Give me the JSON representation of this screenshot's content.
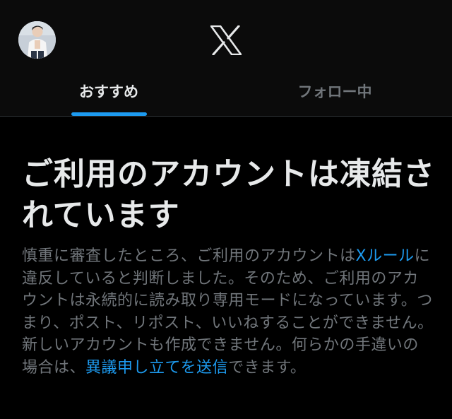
{
  "colors": {
    "background": "#000000",
    "header_background": "#0b0b0b",
    "accent": "#1d9bf0",
    "primary_text": "#e7e9ea",
    "secondary_text": "#71767b"
  },
  "header": {
    "avatar_icon": "user-avatar",
    "logo_icon": "x-logo"
  },
  "tabs": [
    {
      "label": "おすすめ",
      "selected": true
    },
    {
      "label": "フォロー中",
      "selected": false
    }
  ],
  "notice": {
    "title": "ご利用のアカウントは凍結されています",
    "body_part1": "慎重に審査したところ、ご利用のアカウントは",
    "rules_link": "Xルール",
    "body_part2": "に違反していると判断しました。そのため、ご利用のアカウントは永続的に読み取り専用モードになっています。つまり、ポスト、リポスト、いいねすることができません。新しいアカウントも作成できません。何らかの手違いの場合は、",
    "appeal_link": "異議申し立てを送信",
    "body_part3": "できます。"
  }
}
